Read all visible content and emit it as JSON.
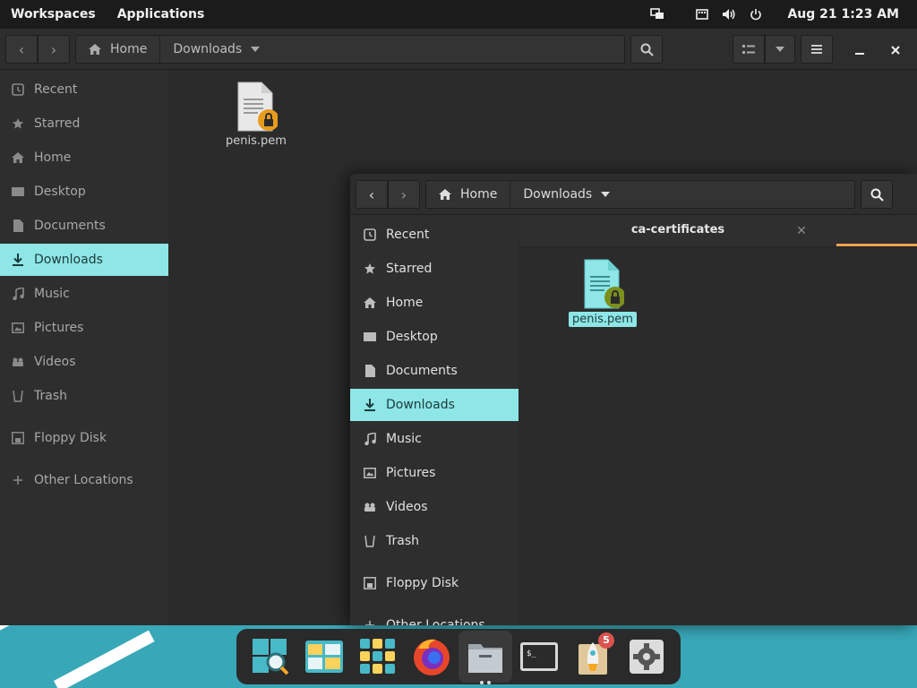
{
  "topbar": {
    "workspaces": "Workspaces",
    "applications": "Applications",
    "clock": "Aug 21  1:23 AM"
  },
  "back_window": {
    "path": {
      "home": "Home",
      "current": "Downloads"
    },
    "sidebar": [
      {
        "label": "Recent",
        "icon": "clock-icon"
      },
      {
        "label": "Starred",
        "icon": "star-icon"
      },
      {
        "label": "Home",
        "icon": "home-icon"
      },
      {
        "label": "Desktop",
        "icon": "desktop-icon"
      },
      {
        "label": "Documents",
        "icon": "document-icon"
      },
      {
        "label": "Downloads",
        "icon": "download-icon",
        "active": true
      },
      {
        "label": "Music",
        "icon": "music-icon"
      },
      {
        "label": "Pictures",
        "icon": "pictures-icon"
      },
      {
        "label": "Videos",
        "icon": "videos-icon"
      },
      {
        "label": "Trash",
        "icon": "trash-icon"
      },
      {
        "label": "Floppy Disk",
        "icon": "floppy-icon"
      },
      {
        "label": "Other Locations",
        "icon": "plus-icon"
      }
    ],
    "files": [
      {
        "name": "penis.pem"
      }
    ]
  },
  "front_window": {
    "path": {
      "home": "Home",
      "current": "Downloads"
    },
    "tab_title": "ca-certificates",
    "sidebar": [
      {
        "label": "Recent",
        "icon": "clock-icon"
      },
      {
        "label": "Starred",
        "icon": "star-icon"
      },
      {
        "label": "Home",
        "icon": "home-icon"
      },
      {
        "label": "Desktop",
        "icon": "desktop-icon"
      },
      {
        "label": "Documents",
        "icon": "document-icon"
      },
      {
        "label": "Downloads",
        "icon": "download-icon",
        "active": true
      },
      {
        "label": "Music",
        "icon": "music-icon"
      },
      {
        "label": "Pictures",
        "icon": "pictures-icon"
      },
      {
        "label": "Videos",
        "icon": "videos-icon"
      },
      {
        "label": "Trash",
        "icon": "trash-icon"
      },
      {
        "label": "Floppy Disk",
        "icon": "floppy-icon"
      },
      {
        "label": "Other Locations",
        "icon": "plus-icon"
      }
    ],
    "files": [
      {
        "name": "penis.pem",
        "selected": true
      }
    ]
  },
  "dock": {
    "items": [
      {
        "name": "search-app",
        "icon": "magnifier-icon"
      },
      {
        "name": "workspaces-app",
        "icon": "workspaces-icon"
      },
      {
        "name": "app-grid",
        "icon": "grid-icon"
      },
      {
        "name": "firefox",
        "icon": "firefox-icon"
      },
      {
        "name": "files",
        "icon": "files-icon",
        "active": true
      },
      {
        "name": "terminal",
        "icon": "terminal-icon"
      },
      {
        "name": "pop-shop",
        "icon": "rocket-icon",
        "badge": "5"
      },
      {
        "name": "settings",
        "icon": "gear-icon"
      }
    ]
  },
  "colors": {
    "accent": "#8ee6e6",
    "panel": "#1b1b1b",
    "window": "#2b2b2b",
    "wallpaper": "#38a8b8",
    "badge": "#d9534f",
    "progress": "#f0a050"
  }
}
